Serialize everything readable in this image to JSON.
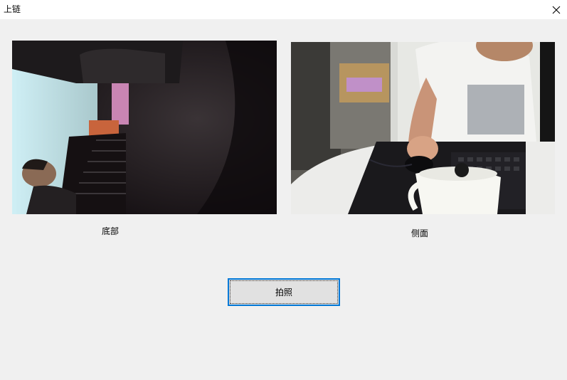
{
  "window": {
    "title": "上链"
  },
  "cameras": {
    "bottom": {
      "label": "底部"
    },
    "side": {
      "label": "侧面"
    }
  },
  "actions": {
    "capture_label": "拍照"
  }
}
